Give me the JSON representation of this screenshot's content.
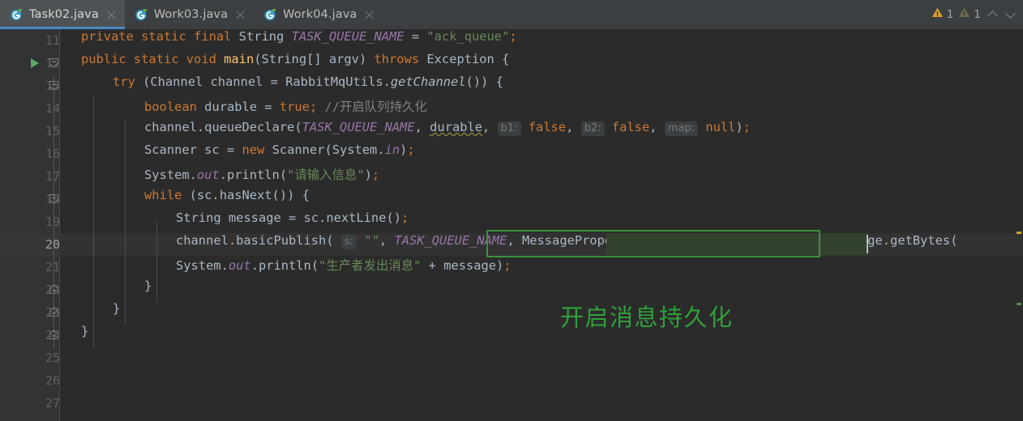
{
  "window": {
    "app": "IntelliJ IDEA Editor",
    "theme_bg": "#2b2b2b",
    "accent": "#4a88c7"
  },
  "tabs": [
    {
      "label": "Task02.java",
      "icon": "java-class-run-icon",
      "active": true,
      "close_icon": "close-icon"
    },
    {
      "label": "Work03.java",
      "icon": "java-class-run-icon",
      "active": false,
      "close_icon": "close-icon"
    },
    {
      "label": "Work04.java",
      "icon": "java-class-run-icon",
      "active": false,
      "close_icon": "close-icon"
    }
  ],
  "inspections": {
    "warning_icon": "warning-triangle-icon",
    "warning_count": "1",
    "weak_warning_icon": "weak-warning-triangle-icon",
    "weak_warning_count": "1",
    "prev_icon": "chevron-up-icon",
    "next_icon": "chevron-down-icon",
    "warning_color": "#d9a125",
    "weak_warning_color": "#6e6b4f"
  },
  "editor": {
    "current_line": 20,
    "first_line": 11,
    "last_line": 27,
    "run_gutter_line": 12,
    "annotation": {
      "text": "开启消息持久化",
      "color": "#2fa03a"
    },
    "highlight_box": {
      "text": "MessageProperties.PERSISTENT_TEXT_PLAIN",
      "border_color": "#3d9140"
    },
    "lines": [
      {
        "n": "11",
        "text": "private static final String TASK_QUEUE_NAME = \"ack_queue\";"
      },
      {
        "n": "12",
        "text": "public static void main(String[] argv) throws Exception {"
      },
      {
        "n": "13",
        "text": "try (Channel channel = RabbitMqUtils.getChannel()) {"
      },
      {
        "n": "14",
        "text": "boolean durable = true; //开启队列持久化"
      },
      {
        "n": "15",
        "text": "channel.queueDeclare(TASK_QUEUE_NAME, durable, b1: false, b2: false, map: null);"
      },
      {
        "n": "16",
        "text": "Scanner sc = new Scanner(System.in);"
      },
      {
        "n": "17",
        "text": "System.out.println(\"请输入信息\");"
      },
      {
        "n": "18",
        "text": "while (sc.hasNext()) {"
      },
      {
        "n": "19",
        "text": "String message = sc.nextLine();"
      },
      {
        "n": "20",
        "text": "channel.basicPublish( s: \"\", TASK_QUEUE_NAME, MessageProperties.PERSISTENT_TEXT_PLAIN, message.getBytes("
      },
      {
        "n": "21",
        "text": "System.out.println(\"生产者发出消息\" + message);"
      },
      {
        "n": "22",
        "text": "}"
      },
      {
        "n": "23",
        "text": "}"
      },
      {
        "n": "24",
        "text": "}"
      },
      {
        "n": "25",
        "text": ""
      },
      {
        "n": "26",
        "text": ""
      },
      {
        "n": "27",
        "text": ""
      }
    ],
    "param_hints": [
      "b1:",
      "b2:",
      "map:",
      "s:"
    ],
    "tokens": {
      "keyword_color": "#cc7832",
      "string_color": "#6a8759",
      "field_color": "#9876aa",
      "comment_color": "#808080",
      "plain_color": "#a9b7c6"
    }
  }
}
